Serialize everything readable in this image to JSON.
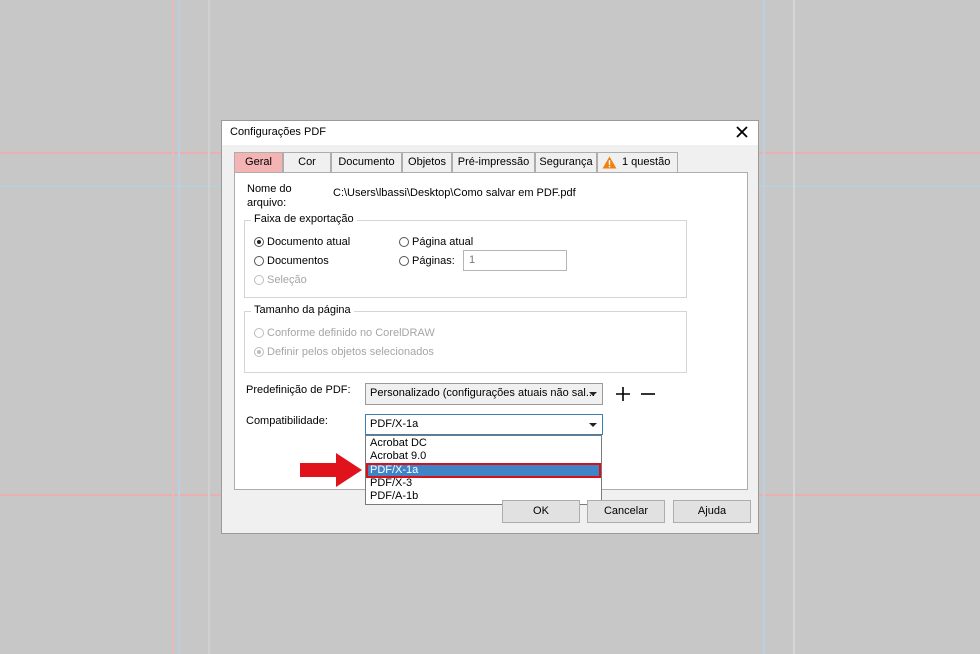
{
  "dialog": {
    "title": "Configurações PDF",
    "tabs": [
      {
        "label": "Geral"
      },
      {
        "label": "Cor"
      },
      {
        "label": "Documento"
      },
      {
        "label": "Objetos"
      },
      {
        "label": "Pré-impressão"
      },
      {
        "label": "Segurança"
      },
      {
        "label": "1 questão"
      }
    ],
    "file": {
      "label_line1": "Nome do",
      "label_line2": "arquivo:",
      "path": "C:\\Users\\lbassi\\Desktop\\Como salvar em PDF.pdf"
    },
    "export_range": {
      "title": "Faixa de exportação",
      "current_document": "Documento atual",
      "documents": "Documentos",
      "selection": "Seleção",
      "current_page": "Página atual",
      "pages": "Páginas:",
      "pages_value": "1"
    },
    "page_size": {
      "title": "Tamanho da página",
      "as_defined": "Conforme definido no CorelDRAW",
      "by_objects": "Definir pelos objetos selecionados"
    },
    "preset": {
      "label": "Predefinição de PDF:",
      "value": "Personalizado (configurações atuais não sal..."
    },
    "compat": {
      "label": "Compatibilidade:",
      "value": "PDF/X-1a",
      "options": [
        "Acrobat DC",
        "Acrobat 9.0",
        "PDF/X-1a",
        "PDF/X-3",
        "PDF/A-1b"
      ],
      "selected": "PDF/X-1a"
    },
    "buttons": {
      "ok": "OK",
      "cancel": "Cancelar",
      "help": "Ajuda"
    }
  },
  "colors": {
    "active_tab": "#f4b4b4",
    "highlight": "#3e84c6",
    "annotation_red": "#e0121b",
    "warning": "#f07f12"
  }
}
